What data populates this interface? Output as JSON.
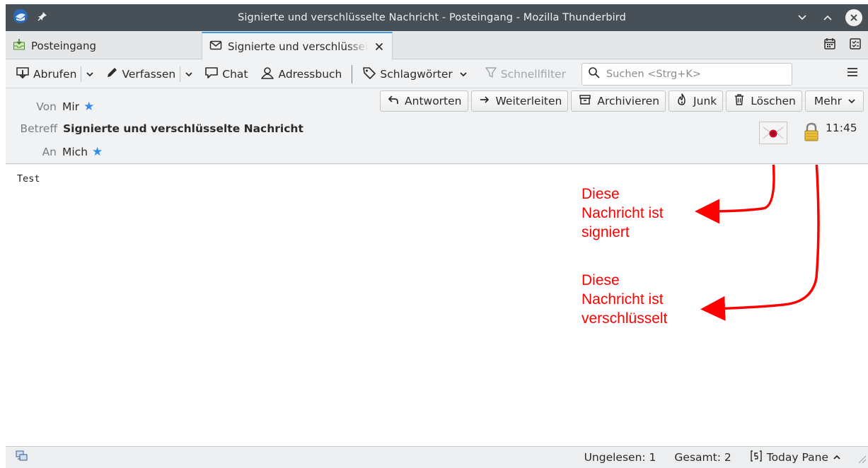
{
  "window": {
    "title": "Signierte und verschlüsselte Nachricht - Posteingang - Mozilla Thunderbird",
    "app_icon": "thunderbird-icon",
    "pin_icon": "pin-icon"
  },
  "tabs": [
    {
      "label": "Posteingang",
      "icon": "inbox-icon"
    },
    {
      "label": "Signierte und verschlüsselte Nachricht",
      "icon": "envelope-icon",
      "active": true
    }
  ],
  "toolbar": {
    "get_messages": "Abrufen",
    "write": "Verfassen",
    "chat": "Chat",
    "address_book": "Adressbuch",
    "tags": "Schlagwörter",
    "quick_filter": "Schnellfilter",
    "search_placeholder": "Suchen <Strg+K>"
  },
  "message_header": {
    "from_label": "Von",
    "from_value": "Mir",
    "subject_label": "Betreff",
    "subject_value": "Signierte und verschlüsselte Nachricht",
    "to_label": "An",
    "to_value": "Mich",
    "time": "11:45",
    "actions": {
      "reply": "Antworten",
      "forward": "Weiterleiten",
      "archive": "Archivieren",
      "junk": "Junk",
      "delete": "Löschen",
      "more": "Mehr"
    }
  },
  "body": {
    "text": "Test"
  },
  "annotations": {
    "signed": [
      "Diese",
      "Nachricht ist",
      "signiert"
    ],
    "encrypted": [
      "Diese",
      "Nachricht ist",
      "verschlüsselt"
    ],
    "color": "#ff0000"
  },
  "status_bar": {
    "unread": "Ungelesen: 1",
    "total": "Gesamt: 2",
    "today_pane": "Today Pane"
  },
  "colors": {
    "titlebar": "#475057",
    "accent": "#3d9ae8",
    "star": "#2f8dea"
  }
}
